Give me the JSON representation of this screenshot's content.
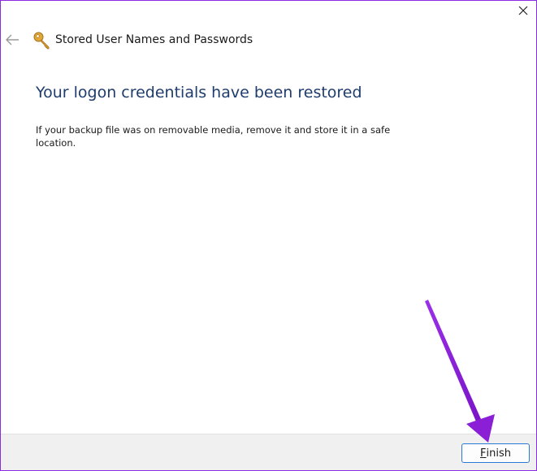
{
  "window": {
    "close_icon": "close-icon"
  },
  "header": {
    "back_icon": "back-arrow-icon",
    "app_icon": "key-icon",
    "title": "Stored User Names and Passwords"
  },
  "content": {
    "heading": "Your logon credentials have been restored",
    "body": "If your backup file was on removable media, remove it and store it in a safe location."
  },
  "footer": {
    "finish_mnemonic": "F",
    "finish_rest": "inish"
  },
  "annotation": {
    "arrow_color": "#8a1fd6",
    "arrow_icon": "pointer-arrow"
  },
  "colors": {
    "heading": "#1e3c6e",
    "border": "#8a2be2",
    "button_border": "#2a7ad4"
  }
}
